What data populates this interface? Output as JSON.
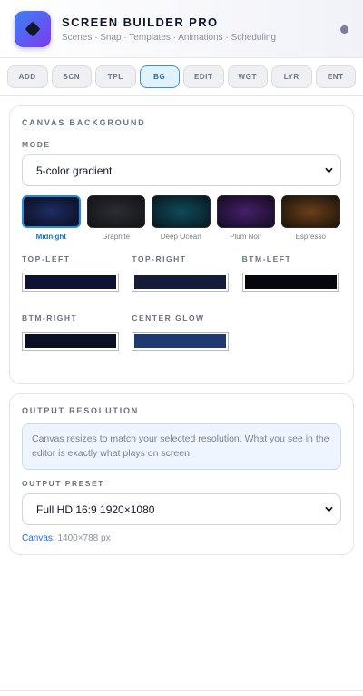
{
  "header": {
    "title": "SCREEN BUILDER PRO",
    "subtitle": "Scenes · Snap · Templates · Animations · Scheduling",
    "logo_icon": "diamond-icon"
  },
  "tabs": [
    {
      "label": "ADD",
      "active": false
    },
    {
      "label": "SCN",
      "active": false
    },
    {
      "label": "TPL",
      "active": false
    },
    {
      "label": "BG",
      "active": true
    },
    {
      "label": "EDIT",
      "active": false
    },
    {
      "label": "WGT",
      "active": false
    },
    {
      "label": "LYR",
      "active": false
    },
    {
      "label": "ENT",
      "active": false
    }
  ],
  "background": {
    "title": "CANVAS BACKGROUND",
    "mode_label": "MODE",
    "mode_value": "5-color gradient",
    "presets": [
      {
        "label": "Midnight",
        "active": true,
        "color": "#1a2650"
      },
      {
        "label": "Graphite",
        "active": false,
        "color": "#2a2b30"
      },
      {
        "label": "Deep Ocean",
        "active": false,
        "color": "#0d3a48"
      },
      {
        "label": "Plum Noir",
        "active": false,
        "color": "#3a1a58"
      },
      {
        "label": "Espresso",
        "active": false,
        "color": "#5a3518"
      }
    ],
    "colors": [
      {
        "label": "TOP-LEFT",
        "color": "#0d1330"
      },
      {
        "label": "TOP-RIGHT",
        "color": "#141c38"
      },
      {
        "label": "BTM-LEFT",
        "color": "#05070d"
      },
      {
        "label": "BTM-RIGHT",
        "color": "#0b1024"
      },
      {
        "label": "CENTER GLOW",
        "color": "#1e3a70"
      }
    ]
  },
  "output": {
    "title": "OUTPUT RESOLUTION",
    "notice": "Canvas resizes to match your selected resolution. What you see in the editor is exactly what plays on screen.",
    "preset_label": "OUTPUT PRESET",
    "preset_value": "Full HD 16:9 1920×1080",
    "canvas_key": "Canvas:",
    "canvas_value": "1400×788 px"
  },
  "colors": {
    "accent": "#1d6fd1",
    "active_tab_border": "#3b93c9"
  }
}
